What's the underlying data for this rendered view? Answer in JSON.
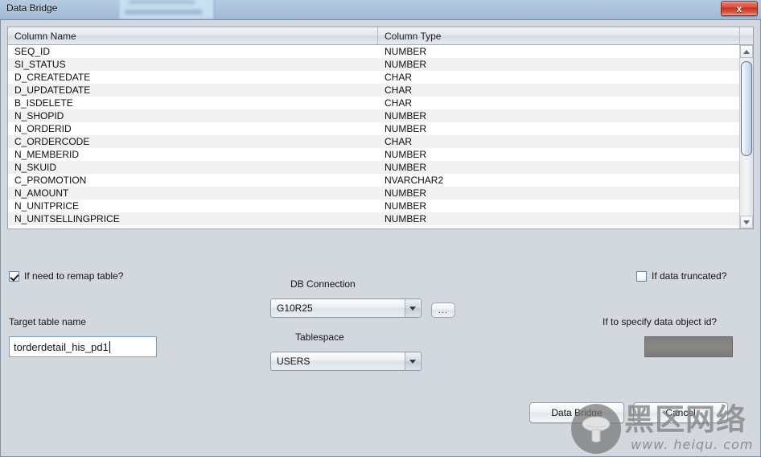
{
  "window": {
    "title": "Data Bridge",
    "close_label": "x"
  },
  "column_list": {
    "headers": {
      "name": "Column Name",
      "type": "Column Type"
    },
    "rows": [
      {
        "name": "SEQ_ID",
        "type": "NUMBER"
      },
      {
        "name": "SI_STATUS",
        "type": "NUMBER"
      },
      {
        "name": "D_CREATEDATE",
        "type": "CHAR"
      },
      {
        "name": "D_UPDATEDATE",
        "type": "CHAR"
      },
      {
        "name": "B_ISDELETE",
        "type": "CHAR"
      },
      {
        "name": "N_SHOPID",
        "type": "NUMBER"
      },
      {
        "name": "N_ORDERID",
        "type": "NUMBER"
      },
      {
        "name": "C_ORDERCODE",
        "type": "CHAR"
      },
      {
        "name": "N_MEMBERID",
        "type": "NUMBER"
      },
      {
        "name": "N_SKUID",
        "type": "NUMBER"
      },
      {
        "name": "C_PROMOTION",
        "type": "NVARCHAR2"
      },
      {
        "name": "N_AMOUNT",
        "type": "NUMBER"
      },
      {
        "name": "N_UNITPRICE",
        "type": "NUMBER"
      },
      {
        "name": "N_UNITSELLINGPRICE",
        "type": "NUMBER"
      }
    ]
  },
  "form": {
    "remap_checkbox_label": "If need to remap table?",
    "remap_checkbox_checked": true,
    "target_table_label": "Target table name",
    "target_table_value": "torderdetail_his_pd1",
    "target_table_placeholder": "",
    "db_connection_label": "DB Connection",
    "db_connection_value": "G10R25",
    "browse_button_label": "...",
    "tablespace_label": "Tablespace",
    "tablespace_value": "USERS",
    "truncated_checkbox_label": "If data truncated?",
    "truncated_checkbox_checked": false,
    "data_object_id_label": "If to specify data object id?",
    "data_object_id_value": ""
  },
  "actions": {
    "primary_label": "Data Bridge",
    "cancel_label": "Cancel"
  },
  "watermark": {
    "brand": "黑区网络",
    "url": "www. heiqu. com"
  },
  "colors": {
    "titlebar": "#a9c1da",
    "dialog_bg": "#d3d8de",
    "close_button": "#c4301c",
    "accent_border": "#7ba0c4",
    "scroll_thumb": "#cfe0f2"
  }
}
